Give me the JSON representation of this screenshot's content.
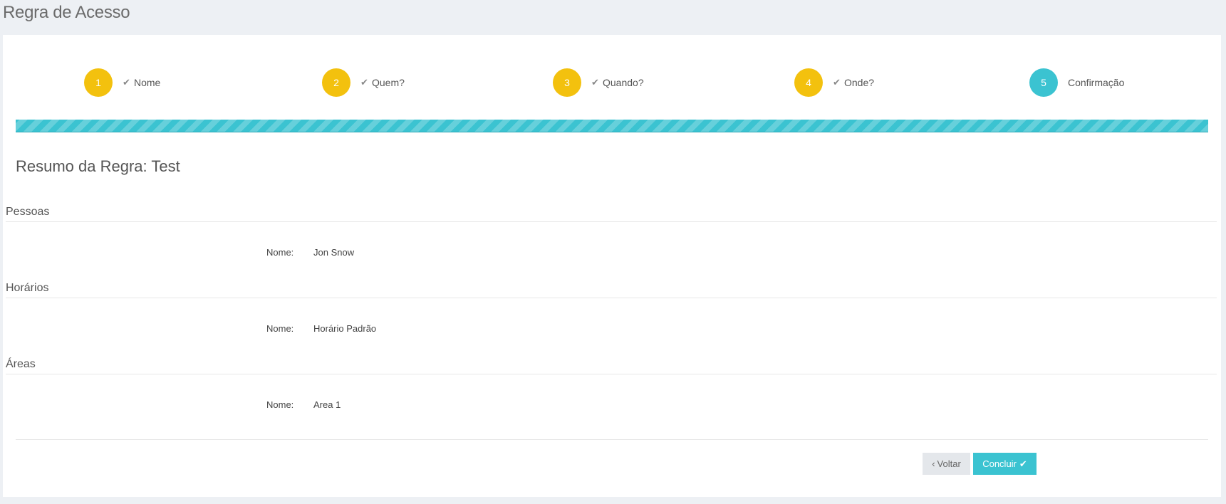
{
  "page": {
    "title": "Regra de Acesso"
  },
  "wizard": {
    "steps": [
      {
        "number": "1",
        "label": "Nome",
        "check": "✔",
        "state": "completed"
      },
      {
        "number": "2",
        "label": "Quem?",
        "check": "✔",
        "state": "completed"
      },
      {
        "number": "3",
        "label": "Quando?",
        "check": "✔",
        "state": "completed"
      },
      {
        "number": "4",
        "label": "Onde?",
        "check": "✔",
        "state": "completed"
      },
      {
        "number": "5",
        "label": "Confirmação",
        "state": "active"
      }
    ],
    "progress_percent": 100
  },
  "summary": {
    "title": "Resumo da Regra: Test",
    "sections": [
      {
        "heading": "Pessoas",
        "field_label": "Nome:",
        "field_value": "Jon Snow"
      },
      {
        "heading": "Horários",
        "field_label": "Nome:",
        "field_value": "Horário Padrão"
      },
      {
        "heading": "Áreas",
        "field_label": "Nome:",
        "field_value": "Area 1"
      }
    ]
  },
  "actions": {
    "back_icon": "‹",
    "back_label": "Voltar",
    "done_label": "Concluir",
    "done_icon": "✔"
  },
  "colors": {
    "completed_step": "#f3c10e",
    "active_step": "#3bc3d1",
    "progress_bar": "#3bc3d1",
    "primary_button": "#3bc3d1",
    "secondary_button": "#e4e7eb",
    "page_background": "#edf0f4"
  },
  "icons": {
    "step_check": "check-icon",
    "back": "chevron-left-icon",
    "done": "check-icon"
  }
}
